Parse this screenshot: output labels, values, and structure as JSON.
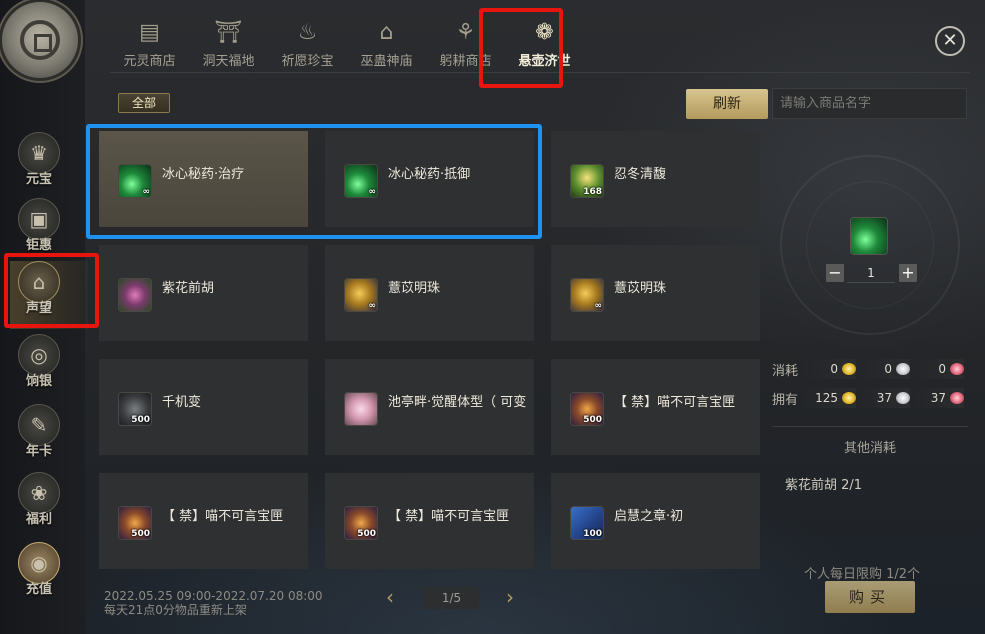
{
  "tabs": [
    {
      "label": "元灵商店",
      "icon": "shop-icon"
    },
    {
      "label": "洞天福地",
      "icon": "palace-icon"
    },
    {
      "label": "祈愿珍宝",
      "icon": "treasure-icon"
    },
    {
      "label": "巫蛊神庙",
      "icon": "temple-icon"
    },
    {
      "label": "躬耕商店",
      "icon": "farm-icon"
    },
    {
      "label": "悬壶济世",
      "icon": "lotus-icon"
    }
  ],
  "active_tab": "悬壶济世",
  "sidebar": [
    {
      "label": "元宝",
      "icon": "ingot-icon"
    },
    {
      "label": "钜惠",
      "icon": "gift-box-icon"
    },
    {
      "label": "声望",
      "icon": "reputation-icon"
    },
    {
      "label": "饷银",
      "icon": "coin-icon"
    },
    {
      "label": "年卡",
      "icon": "card-icon"
    },
    {
      "label": "福利",
      "icon": "welfare-bag-icon"
    },
    {
      "label": "充值",
      "icon": "recharge-icon"
    }
  ],
  "filter": {
    "label": "全部"
  },
  "refresh_label": "刷新",
  "search": {
    "placeholder": "请输入商品名字",
    "value": ""
  },
  "items": [
    {
      "name": "冰心秘药·治疗",
      "count": "∞",
      "icon": "green-potion-icon",
      "selected": true
    },
    {
      "name": "冰心秘药·抵御",
      "count": "∞",
      "icon": "green-potion-icon",
      "selected": false
    },
    {
      "name": "忍冬清馥",
      "count": "168",
      "icon": "honeysuckle-icon",
      "selected": false
    },
    {
      "name": "紫花前胡",
      "count": "",
      "icon": "purple-flower-icon",
      "selected": false
    },
    {
      "name": "薏苡明珠",
      "count": "∞",
      "icon": "pearl-icon",
      "selected": false
    },
    {
      "name": "薏苡明珠",
      "count": "∞",
      "icon": "pearl-icon",
      "selected": false
    },
    {
      "name": "千机变",
      "count": "500",
      "icon": "gear-icon",
      "selected": false
    },
    {
      "name": "池亭畔·觉醒体型（ 可变",
      "count": "",
      "icon": "pink-outfit-icon",
      "selected": false
    },
    {
      "name": "【 禁】喵不可言宝匣",
      "count": "500",
      "icon": "cat-box-icon",
      "selected": false
    },
    {
      "name": "【 禁】喵不可言宝匣",
      "count": "500",
      "icon": "cat-box-icon",
      "selected": false
    },
    {
      "name": "【 禁】喵不可言宝匣",
      "count": "500",
      "icon": "cat-box-icon",
      "selected": false
    },
    {
      "name": "启慧之章·初",
      "count": "100",
      "icon": "book-icon",
      "selected": false
    }
  ],
  "footer": {
    "period": "2022.05.25 09:00-2022.07.20 08:00",
    "restock": "每天21点0分物品重新上架",
    "page": "1/5"
  },
  "detail": {
    "quantity": "1",
    "minus": "−",
    "plus": "+",
    "cost_label": "消耗",
    "cost_values": [
      "0",
      "0",
      "0"
    ],
    "own_label": "拥有",
    "own_values": [
      "125",
      "37",
      "37"
    ],
    "other_cost_title": "其他消耗",
    "other_cost_item": "紫花前胡 2/1",
    "daily_limit": "个人每日限购 1/2个",
    "buy_label": "购买"
  },
  "colors": {
    "highlight_red": "#e8150f",
    "highlight_blue": "#1f93ef",
    "gold_button": "#c9b273"
  }
}
